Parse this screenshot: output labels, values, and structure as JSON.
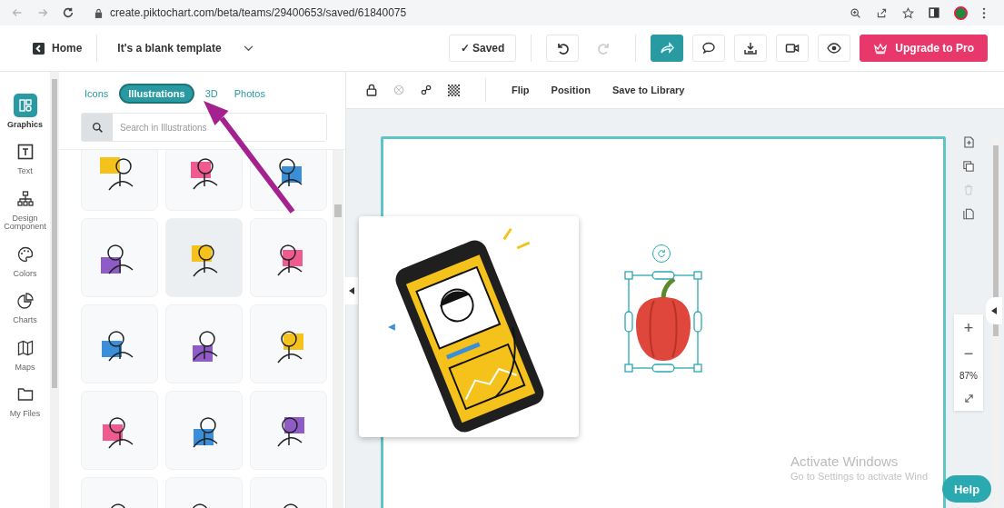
{
  "browser": {
    "url": "create.piktochart.com/beta/teams/29400653/saved/61840075",
    "back_disabled": true,
    "forward_disabled": true
  },
  "header": {
    "home": "Home",
    "title": "It's a blank template",
    "saved": "✓ Saved",
    "undo_disabled": false,
    "redo_disabled": true,
    "upgrade": "Upgrade to Pro"
  },
  "rail": [
    {
      "kind": "graphics",
      "label": "Graphics",
      "selected": true
    },
    {
      "kind": "text",
      "label": "Text",
      "selected": false
    },
    {
      "kind": "design",
      "label": "Design Component",
      "selected": false
    },
    {
      "kind": "colors",
      "label": "Colors",
      "selected": false
    },
    {
      "kind": "charts",
      "label": "Charts",
      "selected": false
    },
    {
      "kind": "maps",
      "label": "Maps",
      "selected": false
    },
    {
      "kind": "files",
      "label": "My Files",
      "selected": false
    }
  ],
  "panel": {
    "tabs": [
      {
        "label": "Icons",
        "selected": false
      },
      {
        "label": "Illustrations",
        "selected": true
      },
      {
        "label": "3D",
        "selected": false
      },
      {
        "label": "Photos",
        "selected": false
      }
    ],
    "search": {
      "placeholder": "Search in Illustrations"
    },
    "thumbnails": [
      {
        "selected": false
      },
      {
        "selected": false
      },
      {
        "selected": false
      },
      {
        "selected": false
      },
      {
        "selected": true
      },
      {
        "selected": false
      },
      {
        "selected": false
      },
      {
        "selected": false
      },
      {
        "selected": false
      },
      {
        "selected": false
      },
      {
        "selected": false
      },
      {
        "selected": false
      },
      {
        "selected": false
      },
      {
        "selected": false
      },
      {
        "selected": false
      }
    ]
  },
  "toolbar": {
    "icons": [
      {
        "kind": "lock",
        "disabled": false
      },
      {
        "kind": "blocked",
        "disabled": true
      },
      {
        "kind": "link",
        "disabled": false
      },
      {
        "kind": "pattern",
        "disabled": false
      }
    ],
    "actions": [
      "Flip",
      "Position",
      "Save to Library"
    ]
  },
  "side_tools": [
    {
      "kind": "add-page",
      "disabled": false
    },
    {
      "kind": "duplicate",
      "disabled": false
    },
    {
      "kind": "delete",
      "disabled": true
    },
    {
      "kind": "copy-page",
      "disabled": false
    }
  ],
  "zoom": {
    "in": "+",
    "out": "−",
    "value": "87%"
  },
  "os_notice": {
    "title": "Activate Windows",
    "text": "Go to Settings to activate Wind"
  },
  "help": "Help"
}
